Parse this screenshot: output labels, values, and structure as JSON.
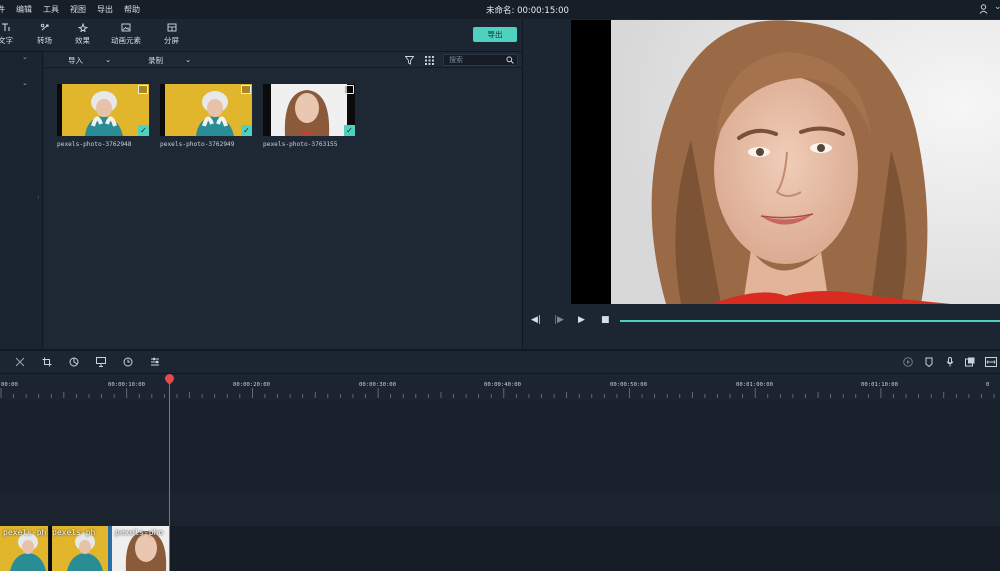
{
  "menu": [
    "件",
    "编辑",
    "工具",
    "视图",
    "导出",
    "帮助"
  ],
  "project": {
    "title": "未命名: 00:00:15:00"
  },
  "toolbar": {
    "tools": [
      {
        "label": "文字",
        "icon": "text-icon"
      },
      {
        "label": "转场",
        "icon": "transition-icon"
      },
      {
        "label": "效果",
        "icon": "effects-icon"
      },
      {
        "label": "动画元素",
        "icon": "elements-icon"
      },
      {
        "label": "分屏",
        "icon": "split-screen-icon"
      }
    ],
    "export_label": "导出"
  },
  "media": {
    "import_label": "导入",
    "record_label": "录制",
    "search_placeholder": "搜索",
    "items": [
      {
        "name": "pexels-photo-3762948",
        "checked": true
      },
      {
        "name": "pexels-photo-3762949",
        "checked": true
      },
      {
        "name": "pexels-photo-3763155",
        "checked": true
      }
    ]
  },
  "timeline": {
    "ticks": [
      "00:00",
      "00:00:10:00",
      "00:00:20:00",
      "00:00:30:00",
      "00:00:40:00",
      "00:00:50:00",
      "00:01:00:00",
      "00:01:10:00"
    ],
    "clips": [
      {
        "label": "pexels-ph"
      },
      {
        "label": "pexels-ph"
      },
      {
        "label": "pexels-pho"
      }
    ]
  },
  "colors": {
    "accent": "#4fd1c0",
    "playhead": "#e5484d",
    "background": "#1b2430"
  }
}
